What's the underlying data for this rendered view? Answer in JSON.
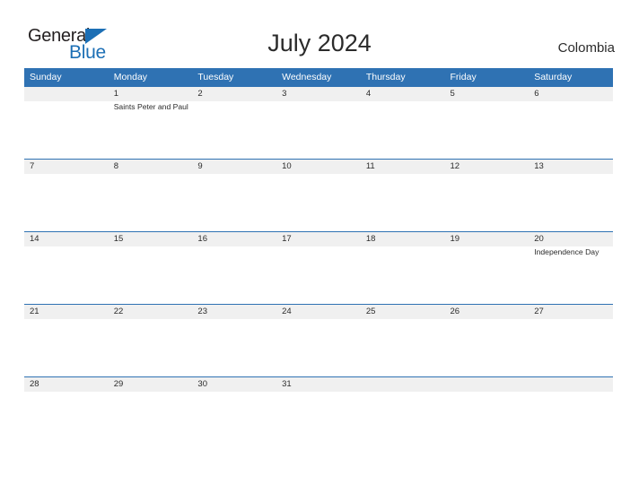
{
  "brand": {
    "word_one": "General",
    "word_two": "Blue"
  },
  "header": {
    "title": "July 2024",
    "country": "Colombia"
  },
  "calendar": {
    "day_headers": [
      "Sunday",
      "Monday",
      "Tuesday",
      "Wednesday",
      "Thursday",
      "Friday",
      "Saturday"
    ],
    "colors": {
      "header_blue": "#2f72b3",
      "band_gray": "#f0f0f0",
      "logo_blue": "#1c6fb5",
      "text": "#2b2b2b"
    },
    "weeks": [
      {
        "days": [
          {
            "num": "",
            "events": []
          },
          {
            "num": "1",
            "events": [
              "Saints Peter and Paul"
            ]
          },
          {
            "num": "2",
            "events": []
          },
          {
            "num": "3",
            "events": []
          },
          {
            "num": "4",
            "events": []
          },
          {
            "num": "5",
            "events": []
          },
          {
            "num": "6",
            "events": []
          }
        ]
      },
      {
        "days": [
          {
            "num": "7",
            "events": []
          },
          {
            "num": "8",
            "events": []
          },
          {
            "num": "9",
            "events": []
          },
          {
            "num": "10",
            "events": []
          },
          {
            "num": "11",
            "events": []
          },
          {
            "num": "12",
            "events": []
          },
          {
            "num": "13",
            "events": []
          }
        ]
      },
      {
        "days": [
          {
            "num": "14",
            "events": []
          },
          {
            "num": "15",
            "events": []
          },
          {
            "num": "16",
            "events": []
          },
          {
            "num": "17",
            "events": []
          },
          {
            "num": "18",
            "events": []
          },
          {
            "num": "19",
            "events": []
          },
          {
            "num": "20",
            "events": [
              "Independence Day"
            ]
          }
        ]
      },
      {
        "days": [
          {
            "num": "21",
            "events": []
          },
          {
            "num": "22",
            "events": []
          },
          {
            "num": "23",
            "events": []
          },
          {
            "num": "24",
            "events": []
          },
          {
            "num": "25",
            "events": []
          },
          {
            "num": "26",
            "events": []
          },
          {
            "num": "27",
            "events": []
          }
        ]
      },
      {
        "days": [
          {
            "num": "28",
            "events": []
          },
          {
            "num": "29",
            "events": []
          },
          {
            "num": "30",
            "events": []
          },
          {
            "num": "31",
            "events": []
          },
          {
            "num": "",
            "events": []
          },
          {
            "num": "",
            "events": []
          },
          {
            "num": "",
            "events": []
          }
        ]
      }
    ]
  }
}
